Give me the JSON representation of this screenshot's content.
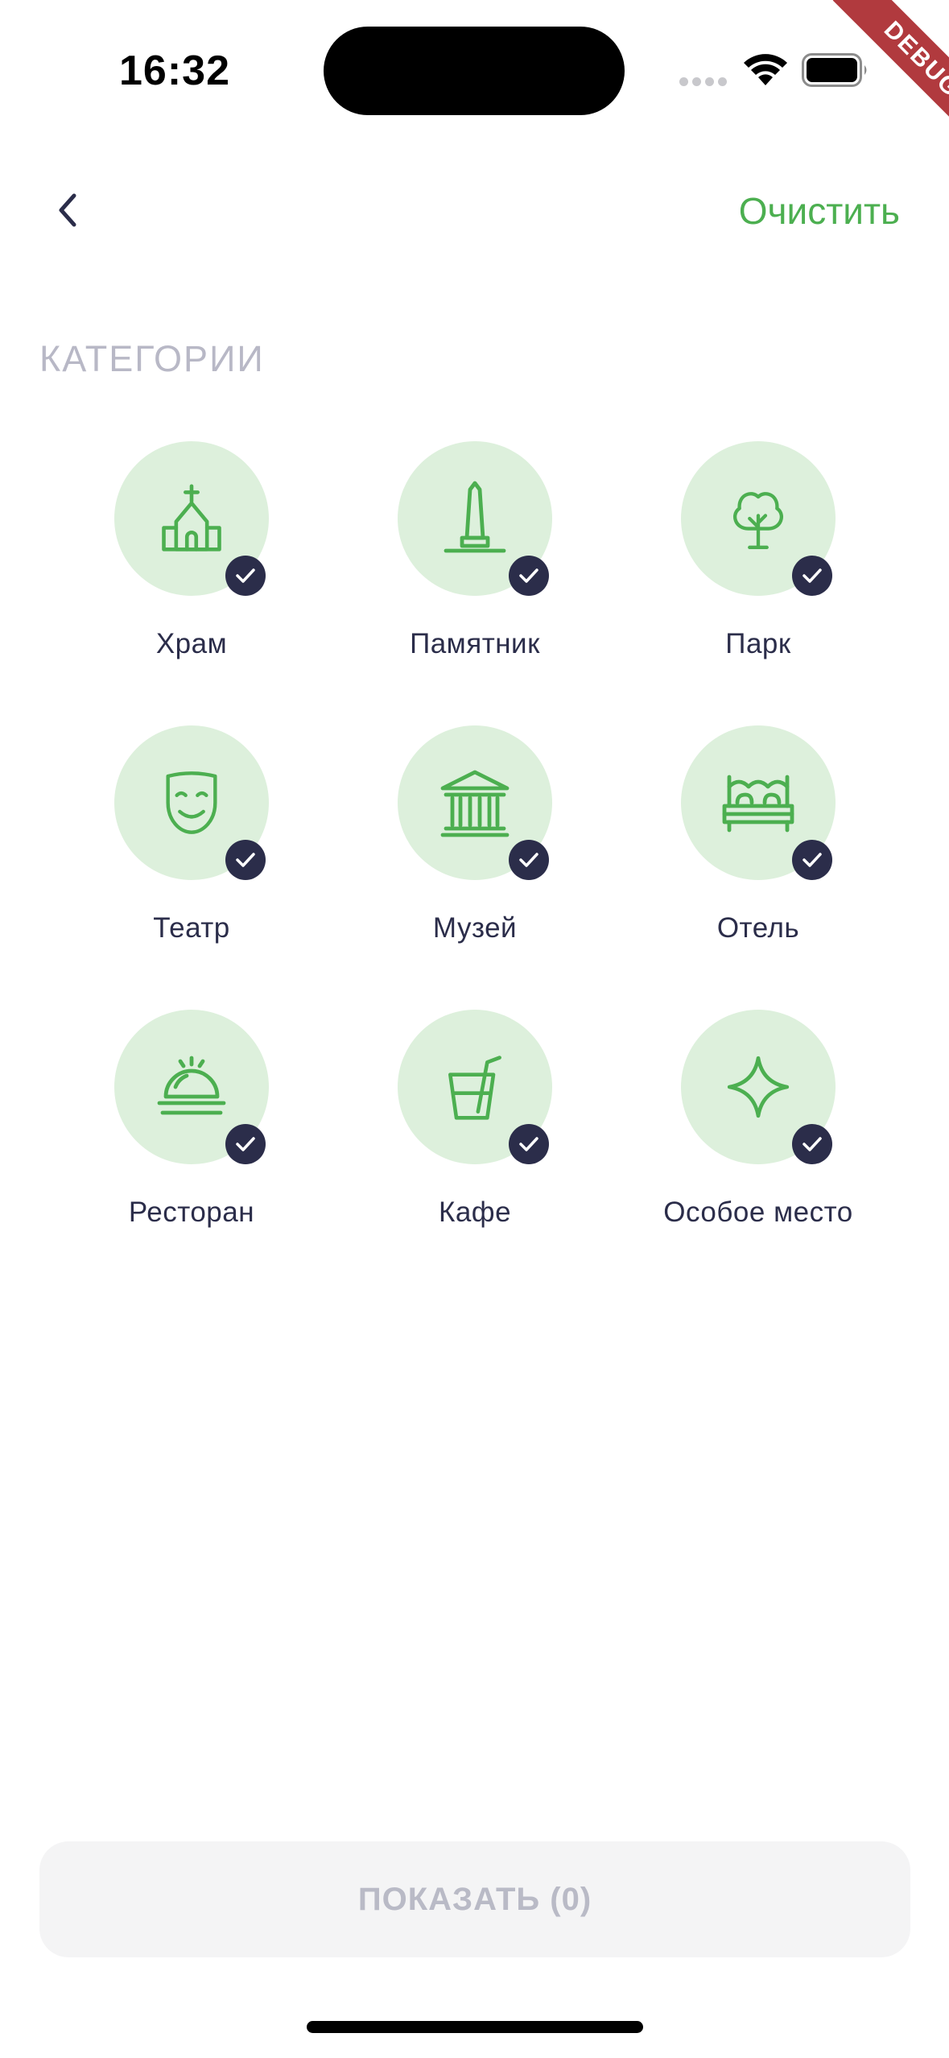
{
  "status_bar": {
    "time": "16:32",
    "debug_label": "DEBUG"
  },
  "header": {
    "back_icon": "chevron-left-icon",
    "clear_label": "Очистить"
  },
  "section": {
    "title": "КАТЕГОРИИ"
  },
  "categories": [
    {
      "label": "Храм",
      "icon": "church-icon",
      "selected": true
    },
    {
      "label": "Памятник",
      "icon": "monument-icon",
      "selected": true
    },
    {
      "label": "Парк",
      "icon": "tree-icon",
      "selected": true
    },
    {
      "label": "Театр",
      "icon": "theater-mask-icon",
      "selected": true
    },
    {
      "label": "Музей",
      "icon": "museum-icon",
      "selected": true
    },
    {
      "label": "Отель",
      "icon": "bed-icon",
      "selected": true
    },
    {
      "label": "Ресторан",
      "icon": "cloche-icon",
      "selected": true
    },
    {
      "label": "Кафе",
      "icon": "drink-icon",
      "selected": true
    },
    {
      "label": "Особое место",
      "icon": "sparkle-icon",
      "selected": true
    }
  ],
  "footer": {
    "show_label": "ПОКАЗАТЬ (0)"
  },
  "colors": {
    "accent": "#4caf50",
    "circle_bg": "#ddf0dc",
    "check_bg": "#2b2d4a",
    "text": "#2b2d4a",
    "muted": "#b8b8c6",
    "button_bg": "#f4f4f5"
  }
}
